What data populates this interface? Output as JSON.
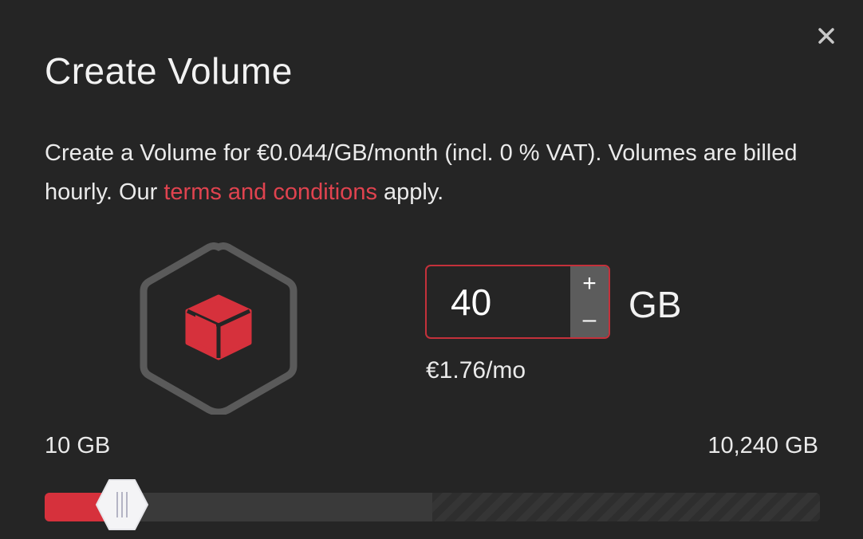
{
  "dialog": {
    "title": "Create Volume",
    "close_icon": "close-icon"
  },
  "description": {
    "text_before_link": "Create a Volume for €0.044/GB/month (incl. 0 % VAT). Volumes are billed hourly. Our ",
    "link_text": "terms and conditions",
    "text_after_link": " apply."
  },
  "graphic": {
    "icon": "cube-icon",
    "hexagon_color": "#5a5a5a",
    "cube_color": "#d6313c"
  },
  "size": {
    "value": "40",
    "increment_label": "+",
    "decrement_label": "–",
    "unit": "GB",
    "price": "€1.76/mo"
  },
  "slider": {
    "min_label": "10 GB",
    "max_label": "10,240 GB",
    "min": 10,
    "max": 10240,
    "value": 40,
    "fill_fraction": 0.1,
    "available_fraction": 0.5,
    "fill_color": "#d6313c"
  },
  "colors": {
    "background": "#252525",
    "accent": "#d6313c",
    "link": "#e0434f"
  }
}
